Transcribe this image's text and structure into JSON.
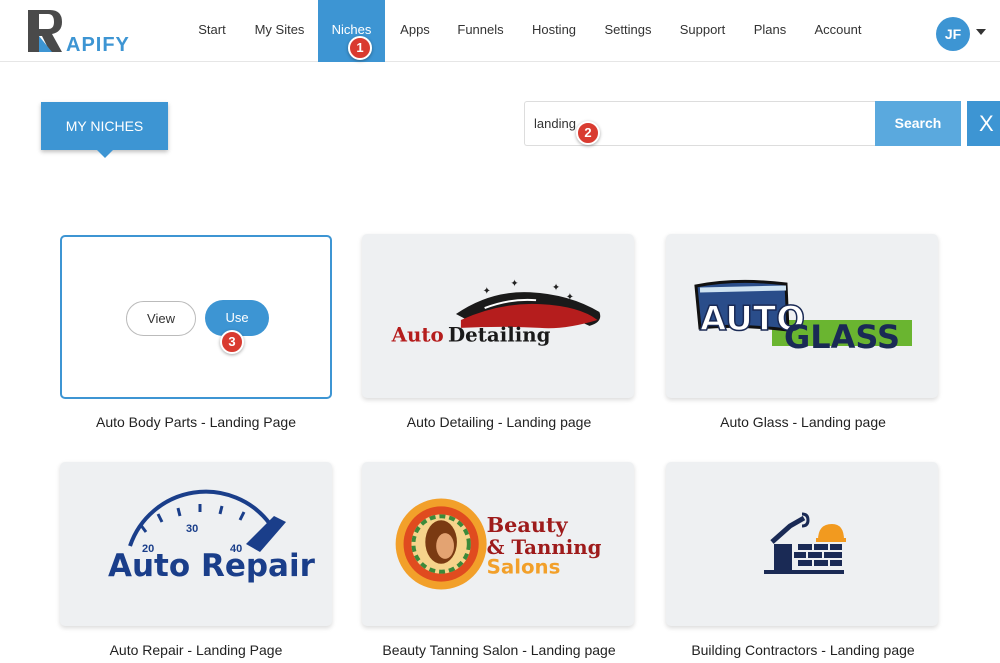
{
  "app": {
    "logo_text": "RAPIFY"
  },
  "nav": {
    "items": [
      {
        "label": "Start"
      },
      {
        "label": "My Sites"
      },
      {
        "label": "Niches"
      },
      {
        "label": "Apps"
      },
      {
        "label": "Funnels"
      },
      {
        "label": "Hosting"
      },
      {
        "label": "Settings"
      },
      {
        "label": "Support"
      },
      {
        "label": "Plans"
      },
      {
        "label": "Account"
      }
    ],
    "active": "Niches",
    "avatar_initials": "JF"
  },
  "markers": [
    "1",
    "2",
    "3"
  ],
  "header": {
    "section_label": "MY NICHES"
  },
  "search": {
    "value": "landing",
    "button_label": "Search",
    "clear_label": "X"
  },
  "niches": [
    {
      "label": "Auto Body Parts - Landing Page",
      "view_label": "View",
      "use_label": "Use"
    },
    {
      "label": "Auto Detailing - Landing page",
      "logo": [
        "Auto",
        "Detailing"
      ]
    },
    {
      "label": "Auto Glass - Landing page",
      "logo": [
        "AUTO",
        "GLASS"
      ]
    },
    {
      "label": "Auto Repair - Landing Page",
      "logo": [
        "Auto Repair",
        "20",
        "30",
        "40"
      ]
    },
    {
      "label": "Beauty Tanning Salon - Landing page",
      "logo": [
        "Beauty",
        "& Tanning",
        "Salons"
      ]
    },
    {
      "label": "Building Contractors - Landing page"
    }
  ],
  "colors": {
    "accent": "#3d95d3",
    "marker": "#d93b30",
    "card_bg": "#eef0f2"
  }
}
